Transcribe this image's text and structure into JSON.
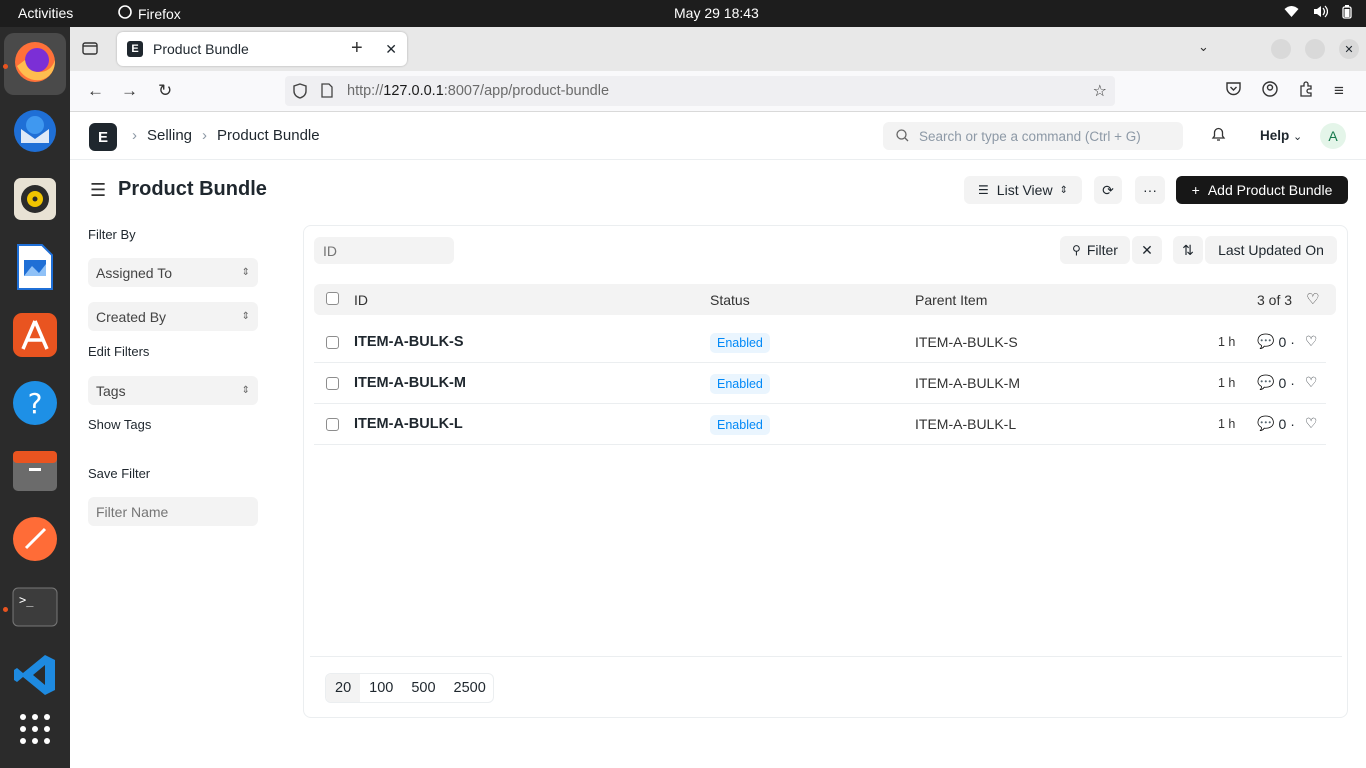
{
  "system_bar": {
    "activities": "Activities",
    "app": "Firefox",
    "clock": "May 29  18:43"
  },
  "browser": {
    "tab_title": "Product Bundle",
    "url_prefix": "http://",
    "url_host": "127.0.0.1",
    "url_rest": ":8007/app/product-bundle"
  },
  "app_header": {
    "logo": "E",
    "breadcrumb": [
      "Selling",
      "Product Bundle"
    ],
    "search_placeholder": "Search or type a command (Ctrl + G)",
    "help": "Help",
    "avatar": "A"
  },
  "page": {
    "title": "Product Bundle",
    "list_view": "List View",
    "add_button": "Add Product Bundle"
  },
  "sidebar": {
    "filter_by": "Filter By",
    "assigned_to": "Assigned To",
    "created_by": "Created By",
    "edit_filters": "Edit Filters",
    "tags": "Tags",
    "show_tags": "Show Tags",
    "save_filter": "Save Filter",
    "filter_name_placeholder": "Filter Name"
  },
  "list": {
    "id_placeholder": "ID",
    "filter": "Filter",
    "sort": "Last Updated On",
    "columns": {
      "id": "ID",
      "status": "Status",
      "parent": "Parent Item",
      "count": "3 of 3"
    },
    "rows": [
      {
        "id": "ITEM-A-BULK-S",
        "status": "Enabled",
        "parent": "ITEM-A-BULK-S",
        "ago": "1 h",
        "comments": "0"
      },
      {
        "id": "ITEM-A-BULK-M",
        "status": "Enabled",
        "parent": "ITEM-A-BULK-M",
        "ago": "1 h",
        "comments": "0"
      },
      {
        "id": "ITEM-A-BULK-L",
        "status": "Enabled",
        "parent": "ITEM-A-BULK-L",
        "ago": "1 h",
        "comments": "0"
      }
    ],
    "page_sizes": [
      "20",
      "100",
      "500",
      "2500"
    ]
  },
  "colors": {
    "accent": "#171717",
    "badge_bg": "#eaf5fe",
    "badge_fg": "#0289f7"
  }
}
